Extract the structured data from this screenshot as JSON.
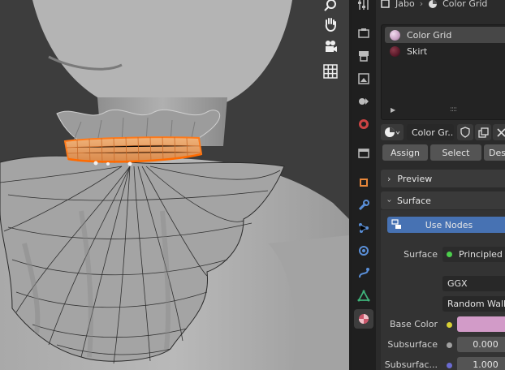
{
  "breadcrumb": {
    "object": "Jabo",
    "material": "Color Grid"
  },
  "material_slots": [
    {
      "name": "Color Grid",
      "color": "#c9a1c4",
      "selected": true
    },
    {
      "name": "Skirt",
      "color": "#5a1a2a",
      "selected": false
    }
  ],
  "material_selector": {
    "name": "Color Gr..."
  },
  "slot_buttons": {
    "assign": "Assign",
    "select": "Select",
    "deselect": "Des"
  },
  "panels": {
    "preview": "Preview",
    "surface": "Surface"
  },
  "surface": {
    "use_nodes": "Use Nodes",
    "surface_label": "Surface",
    "surface_value": "Principled B",
    "distribution": "GGX",
    "subsurface_method": "Random Walk",
    "base_color_label": "Base Color",
    "base_color": "#d29bc8",
    "subsurface_label": "Subsurface",
    "subsurface_value": "0.000",
    "subsurface2_label": "Subsurfac...",
    "subsurface2_value": "1.000"
  },
  "colors": {
    "accent_blue": "#4772b3",
    "selection_orange": "#e8a36a",
    "active_outline": "#ff7a1a"
  }
}
